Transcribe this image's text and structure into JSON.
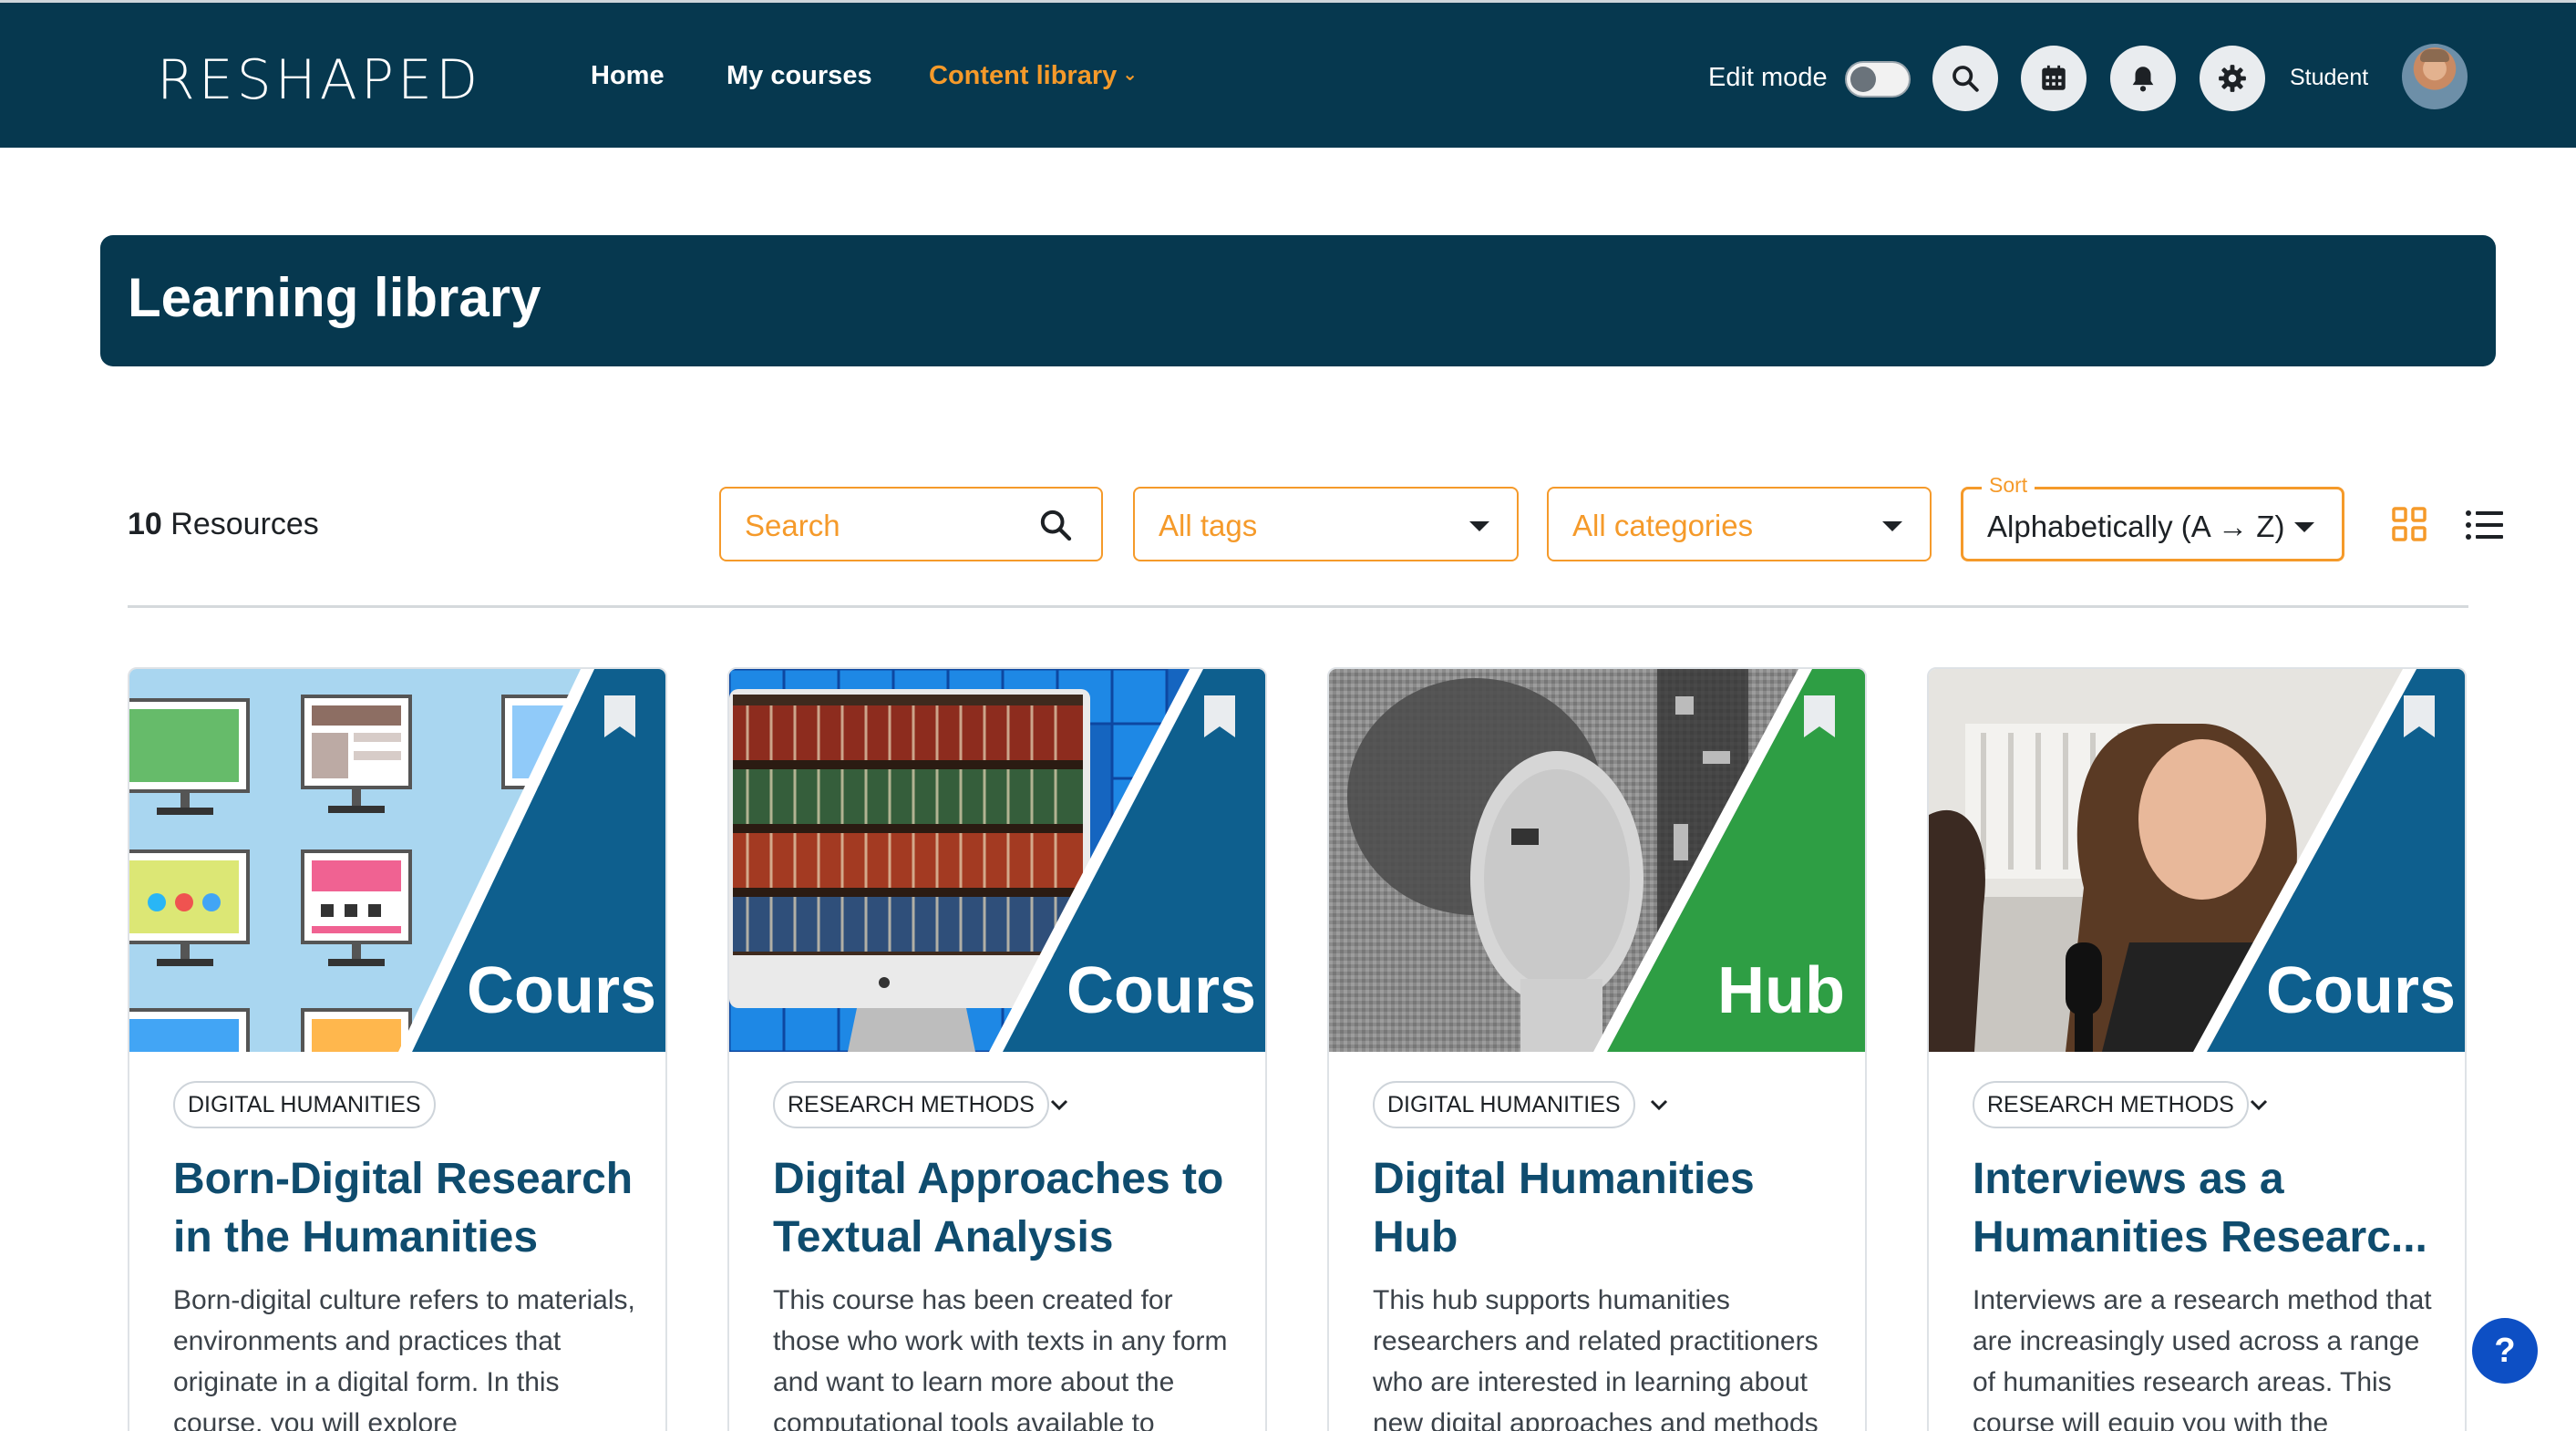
{
  "brand": {
    "logo_text": "RESHAPED"
  },
  "nav": {
    "home": "Home",
    "my_courses": "My courses",
    "content_library": "Content library",
    "edit_mode_label": "Edit mode",
    "edit_mode_on": false,
    "user_role": "Student"
  },
  "header": {
    "title": "Learning library"
  },
  "toolbar": {
    "count": "10",
    "count_suffix": "Resources",
    "search_placeholder": "Search",
    "tags_value": "All tags",
    "categories_value": "All categories",
    "sort_legend": "Sort",
    "sort_value": "Alphabetically (A → Z)",
    "active_view": "grid"
  },
  "colors": {
    "navy": "#06384f",
    "accent_orange": "#f59a2a",
    "course_blue": "#0e5f8e",
    "hub_green": "#2e9e44",
    "title_blue": "#0f4c6e",
    "help_blue": "#0d4fc4"
  },
  "cards": [
    {
      "type": "Cours",
      "tag": "DIGITAL HUMANITIES",
      "tag_expandable": false,
      "title": "Born-Digital Research in the Humanities",
      "description": "Born-digital culture refers to materials, environments and practices that originate in a digital form. In this course, you will explore"
    },
    {
      "type": "Cours",
      "tag": "RESEARCH METHODS",
      "tag_expandable": true,
      "title": "Digital Approaches to Textual Analysis",
      "description": "This course has been created for those who work with texts in any form and want to learn more about the computational tools available to"
    },
    {
      "type": "Hub",
      "tag": "DIGITAL HUMANITIES",
      "tag_expandable": true,
      "title": "Digital Humanities Hub",
      "description": "This hub supports humanities researchers and related practitioners who are interested in learning about new digital approaches and methods"
    },
    {
      "type": "Cours",
      "tag": "RESEARCH METHODS",
      "tag_expandable": true,
      "title": "Interviews as a Humanities Researc...",
      "description": "Interviews are a research method that are increasingly used across a range of humanities research areas. This course will equip you with the"
    }
  ],
  "help": {
    "label": "?"
  },
  "icons": {
    "search": "search-icon",
    "calendar": "calendar-icon",
    "notifications": "bell-icon",
    "settings": "gear-icon",
    "bookmark": "bookmark-icon",
    "grid_view": "grid-view-icon",
    "list_view": "list-view-icon"
  }
}
